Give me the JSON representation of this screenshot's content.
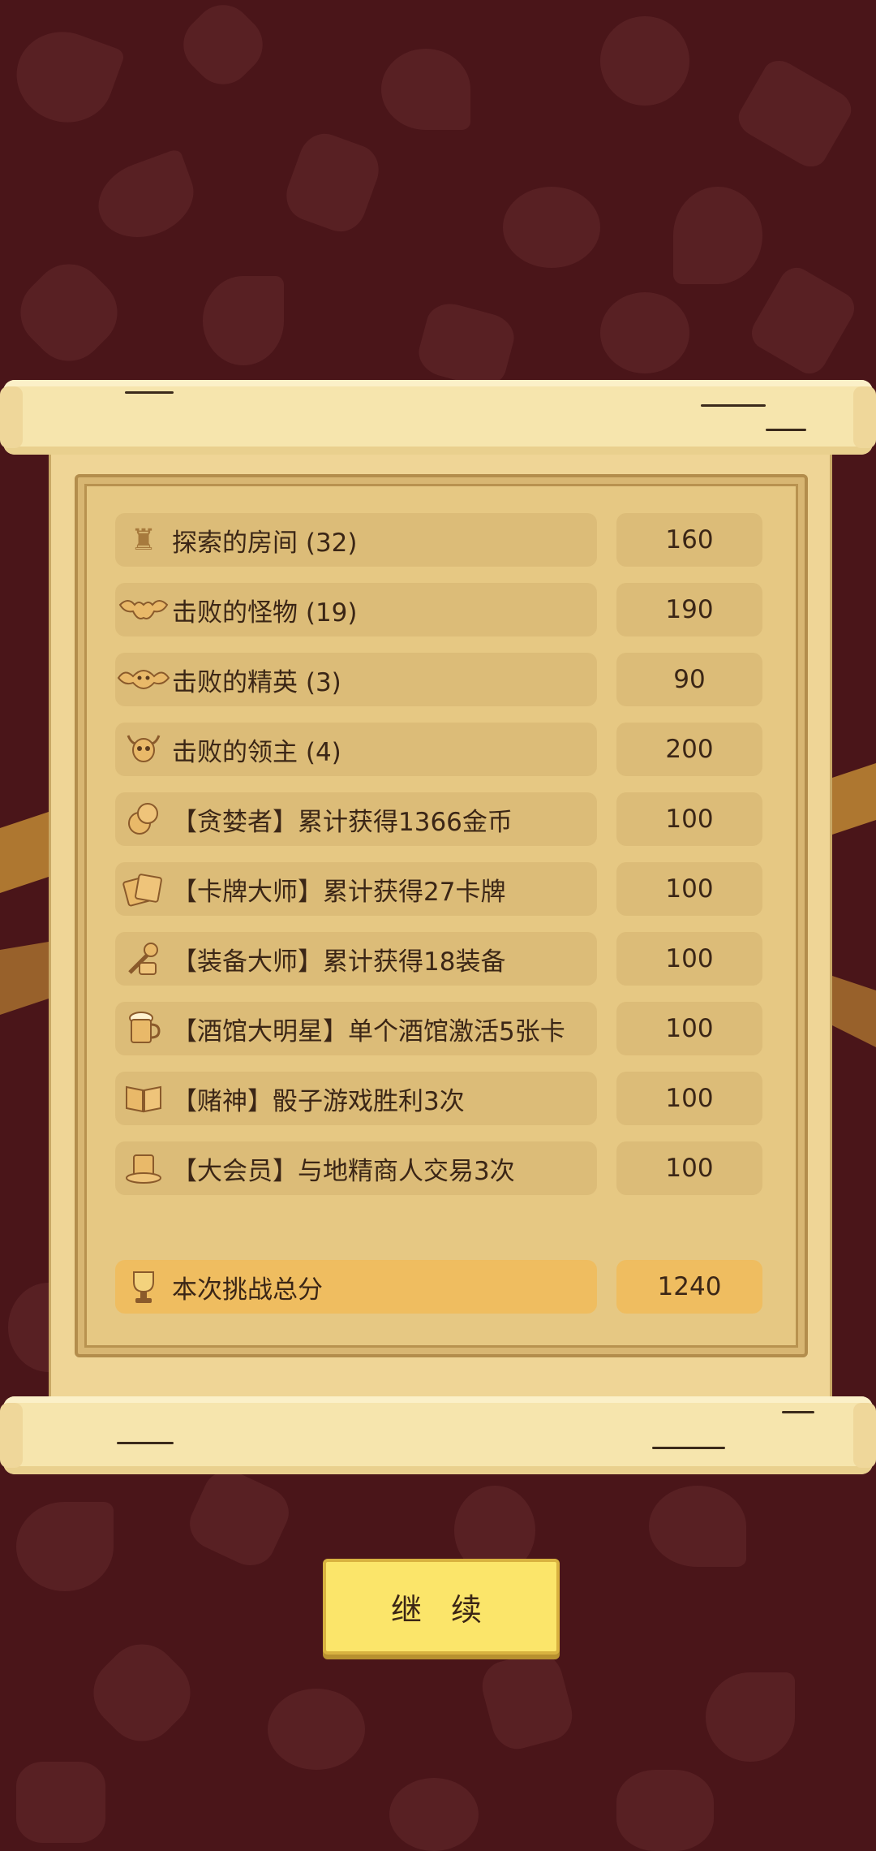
{
  "score_rows": [
    {
      "icon": "tower-icon",
      "label": "探索的房间 (32)",
      "value": "160"
    },
    {
      "icon": "bat-icon",
      "label": "击败的怪物 (19)",
      "value": "190"
    },
    {
      "icon": "demon-bat-icon",
      "label": "击败的精英 (3)",
      "value": "90"
    },
    {
      "icon": "horned-skull-icon",
      "label": "击败的领主 (4)",
      "value": "200"
    },
    {
      "icon": "coins-icon",
      "label": "【贪婪者】累计获得1366金币",
      "value": "100"
    },
    {
      "icon": "cards-icon",
      "label": "【卡牌大师】累计获得27卡牌",
      "value": "100"
    },
    {
      "icon": "equipment-icon",
      "label": "【装备大师】累计获得18装备",
      "value": "100"
    },
    {
      "icon": "beer-mug-icon",
      "label": "【酒馆大明星】单个酒馆激活5张卡",
      "value": "100"
    },
    {
      "icon": "open-book-icon",
      "label": "【赌神】骰子游戏胜利3次",
      "value": "100"
    },
    {
      "icon": "top-hat-icon",
      "label": "【大会员】与地精商人交易3次",
      "value": "100"
    }
  ],
  "total": {
    "icon": "trophy-icon",
    "label": "本次挑战总分",
    "value": "1240"
  },
  "continue_label": "继 续",
  "colors": {
    "background": "#4a1519",
    "parchment": "#efd596",
    "row_box": "#dcbc78",
    "total_box": "#efbd60",
    "button": "#fbe56a"
  }
}
